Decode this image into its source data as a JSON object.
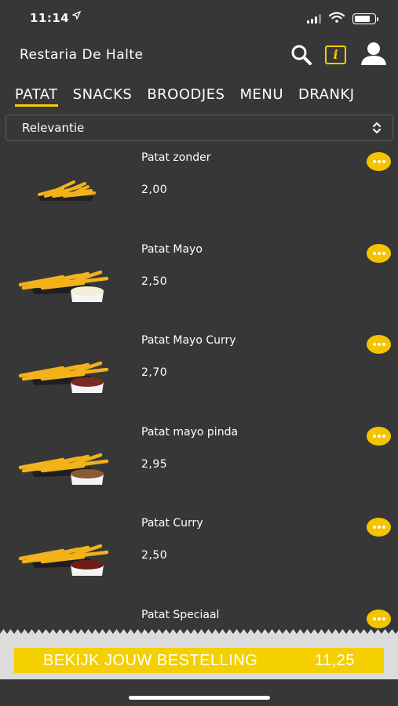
{
  "status_bar": {
    "time": "11:14",
    "location_icon": "navigation-arrow-icon",
    "signal_icon": "cellular-signal-icon",
    "wifi_icon": "wifi-icon",
    "battery_icon": "battery-icon",
    "battery_level": 0.8
  },
  "header": {
    "title": "Restaria De Halte",
    "search_icon": "search-icon",
    "info_icon": "info-icon",
    "info_glyph": "i",
    "account_icon": "user-icon"
  },
  "tabs": [
    {
      "label": "PATAT",
      "active": true
    },
    {
      "label": "SNACKS",
      "active": false
    },
    {
      "label": "BROODJES",
      "active": false
    },
    {
      "label": "MENU",
      "active": false
    },
    {
      "label": "DRANKJ",
      "active": false
    }
  ],
  "sort": {
    "selected": "Relevantie",
    "icon": "chevron-up-down-icon"
  },
  "products": [
    {
      "name": "Patat zonder",
      "price": "2,00",
      "sauce": null
    },
    {
      "name": "Patat Mayo",
      "price": "2,50",
      "sauce": "#f2ecd8"
    },
    {
      "name": "Patat Mayo Curry",
      "price": "2,70",
      "sauce": "#7a2a1e"
    },
    {
      "name": "Patat mayo pinda",
      "price": "2,95",
      "sauce": "#8a5a36"
    },
    {
      "name": "Patat Curry",
      "price": "2,50",
      "sauce": "#6e1e16"
    },
    {
      "name": "Patat Speciaal",
      "price": "",
      "sauce": null
    }
  ],
  "order": {
    "label": "BEKIJK JOUW BESTELLING",
    "total": "11,25"
  },
  "colors": {
    "background": "#373737",
    "accent": "#f5d000",
    "more_button": "#f5c400",
    "order_area": "#dcdcdc"
  }
}
